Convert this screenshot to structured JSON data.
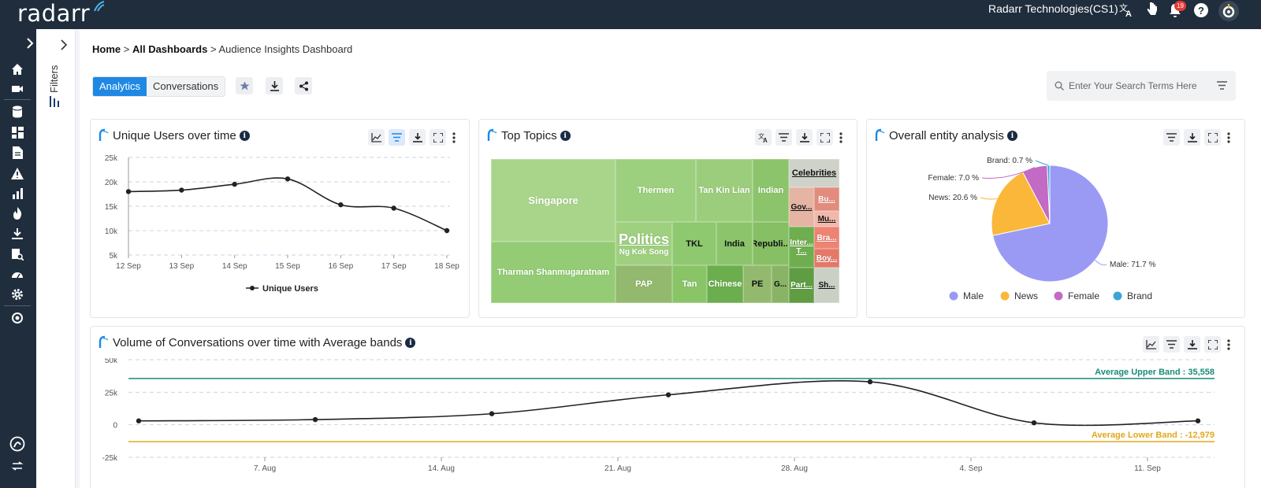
{
  "app": {
    "logo": "radarr",
    "org": "Radarr Technologies(CS1)",
    "notifications": "19"
  },
  "filters_label": "Filters",
  "breadcrumb": {
    "home": "Home",
    "dashboards": "All Dashboards",
    "current": "Audience Insights Dashboard",
    "sep": ">"
  },
  "tabs": {
    "analytics": "Analytics",
    "conversations": "Conversations"
  },
  "search": {
    "placeholder": "Enter Your Search Terms Here"
  },
  "cards": {
    "users": {
      "title": "Unique Users over time",
      "legend": "Unique Users"
    },
    "topics": {
      "title": "Top Topics"
    },
    "entity": {
      "title": "Overall entity analysis"
    },
    "volume": {
      "title": "Volume of Conversations over time with Average bands",
      "upper": "Average Upper Band : 35,558",
      "lower": "Average Lower Band : -12,979"
    }
  },
  "treemap": [
    {
      "label": "Singapore"
    },
    {
      "label": "Thermen"
    },
    {
      "label": "Tan Kin Lian"
    },
    {
      "label": "Indian"
    },
    {
      "label": "Politics"
    },
    {
      "label": "Ng Kok Song"
    },
    {
      "label": "TKL"
    },
    {
      "label": "India"
    },
    {
      "label": "Republi..."
    },
    {
      "label": "Tharman Shanmugaratnam"
    },
    {
      "label": "PAP"
    },
    {
      "label": "Tan"
    },
    {
      "label": "Chinese"
    },
    {
      "label": "PE"
    },
    {
      "label": "G..."
    },
    {
      "label": "Celebrities"
    },
    {
      "label": "Gov..."
    },
    {
      "label": "Bu..."
    },
    {
      "label": "Mu..."
    },
    {
      "label": "Inter..."
    },
    {
      "label": "T..."
    },
    {
      "label": "Bra..."
    },
    {
      "label": "Boy..."
    },
    {
      "label": "Part..."
    },
    {
      "label": "Sh..."
    }
  ],
  "chart_data": [
    {
      "type": "line",
      "title": "Unique Users over time",
      "x": [
        "12 Sep",
        "13 Sep",
        "14 Sep",
        "15 Sep",
        "16 Sep",
        "17 Sep",
        "18 Sep"
      ],
      "series": [
        {
          "name": "Unique Users",
          "values": [
            18000,
            18300,
            19500,
            20600,
            15300,
            14600,
            10000
          ]
        }
      ],
      "yticks": [
        "25k",
        "20k",
        "15k",
        "10k",
        "5k"
      ],
      "ylim": [
        5000,
        25000
      ]
    },
    {
      "type": "pie",
      "title": "Overall entity analysis",
      "slices": [
        {
          "name": "Male",
          "value": 71.7,
          "label": "Male: 71.7 %",
          "color": "#9a9af5"
        },
        {
          "name": "News",
          "value": 20.6,
          "label": "News: 20.6 %",
          "color": "#fbb73a"
        },
        {
          "name": "Female",
          "value": 7.0,
          "label": "Female: 7.0 %",
          "color": "#c26ac4"
        },
        {
          "name": "Brand",
          "value": 0.7,
          "label": "Brand: 0.7 %",
          "color": "#3aa6d8"
        }
      ]
    },
    {
      "type": "line",
      "title": "Volume of Conversations over time with Average bands",
      "x": [
        "7. Aug",
        "14. Aug",
        "21. Aug",
        "28. Aug",
        "4. Sep",
        "11. Sep"
      ],
      "series": [
        {
          "name": "Volume",
          "points": [
            [
              "31 Jul",
              3000
            ],
            [
              "7 Aug",
              4000
            ],
            [
              "14 Aug",
              8500
            ],
            [
              "21 Aug",
              23000
            ],
            [
              "28 Aug",
              33000
            ],
            [
              "4 Sep",
              1500
            ],
            [
              "11 Sep",
              3000
            ]
          ]
        }
      ],
      "yticks": [
        "50k",
        "25k",
        "0",
        "-25k"
      ],
      "ylim": [
        -25000,
        50000
      ],
      "bands": {
        "upper": 35558,
        "lower": -12979
      }
    }
  ],
  "colors": {
    "brand": "#1f2d3d",
    "accent": "#1f88e5",
    "upper_band": "#1a8a7a",
    "lower_band": "#e0a81c"
  }
}
